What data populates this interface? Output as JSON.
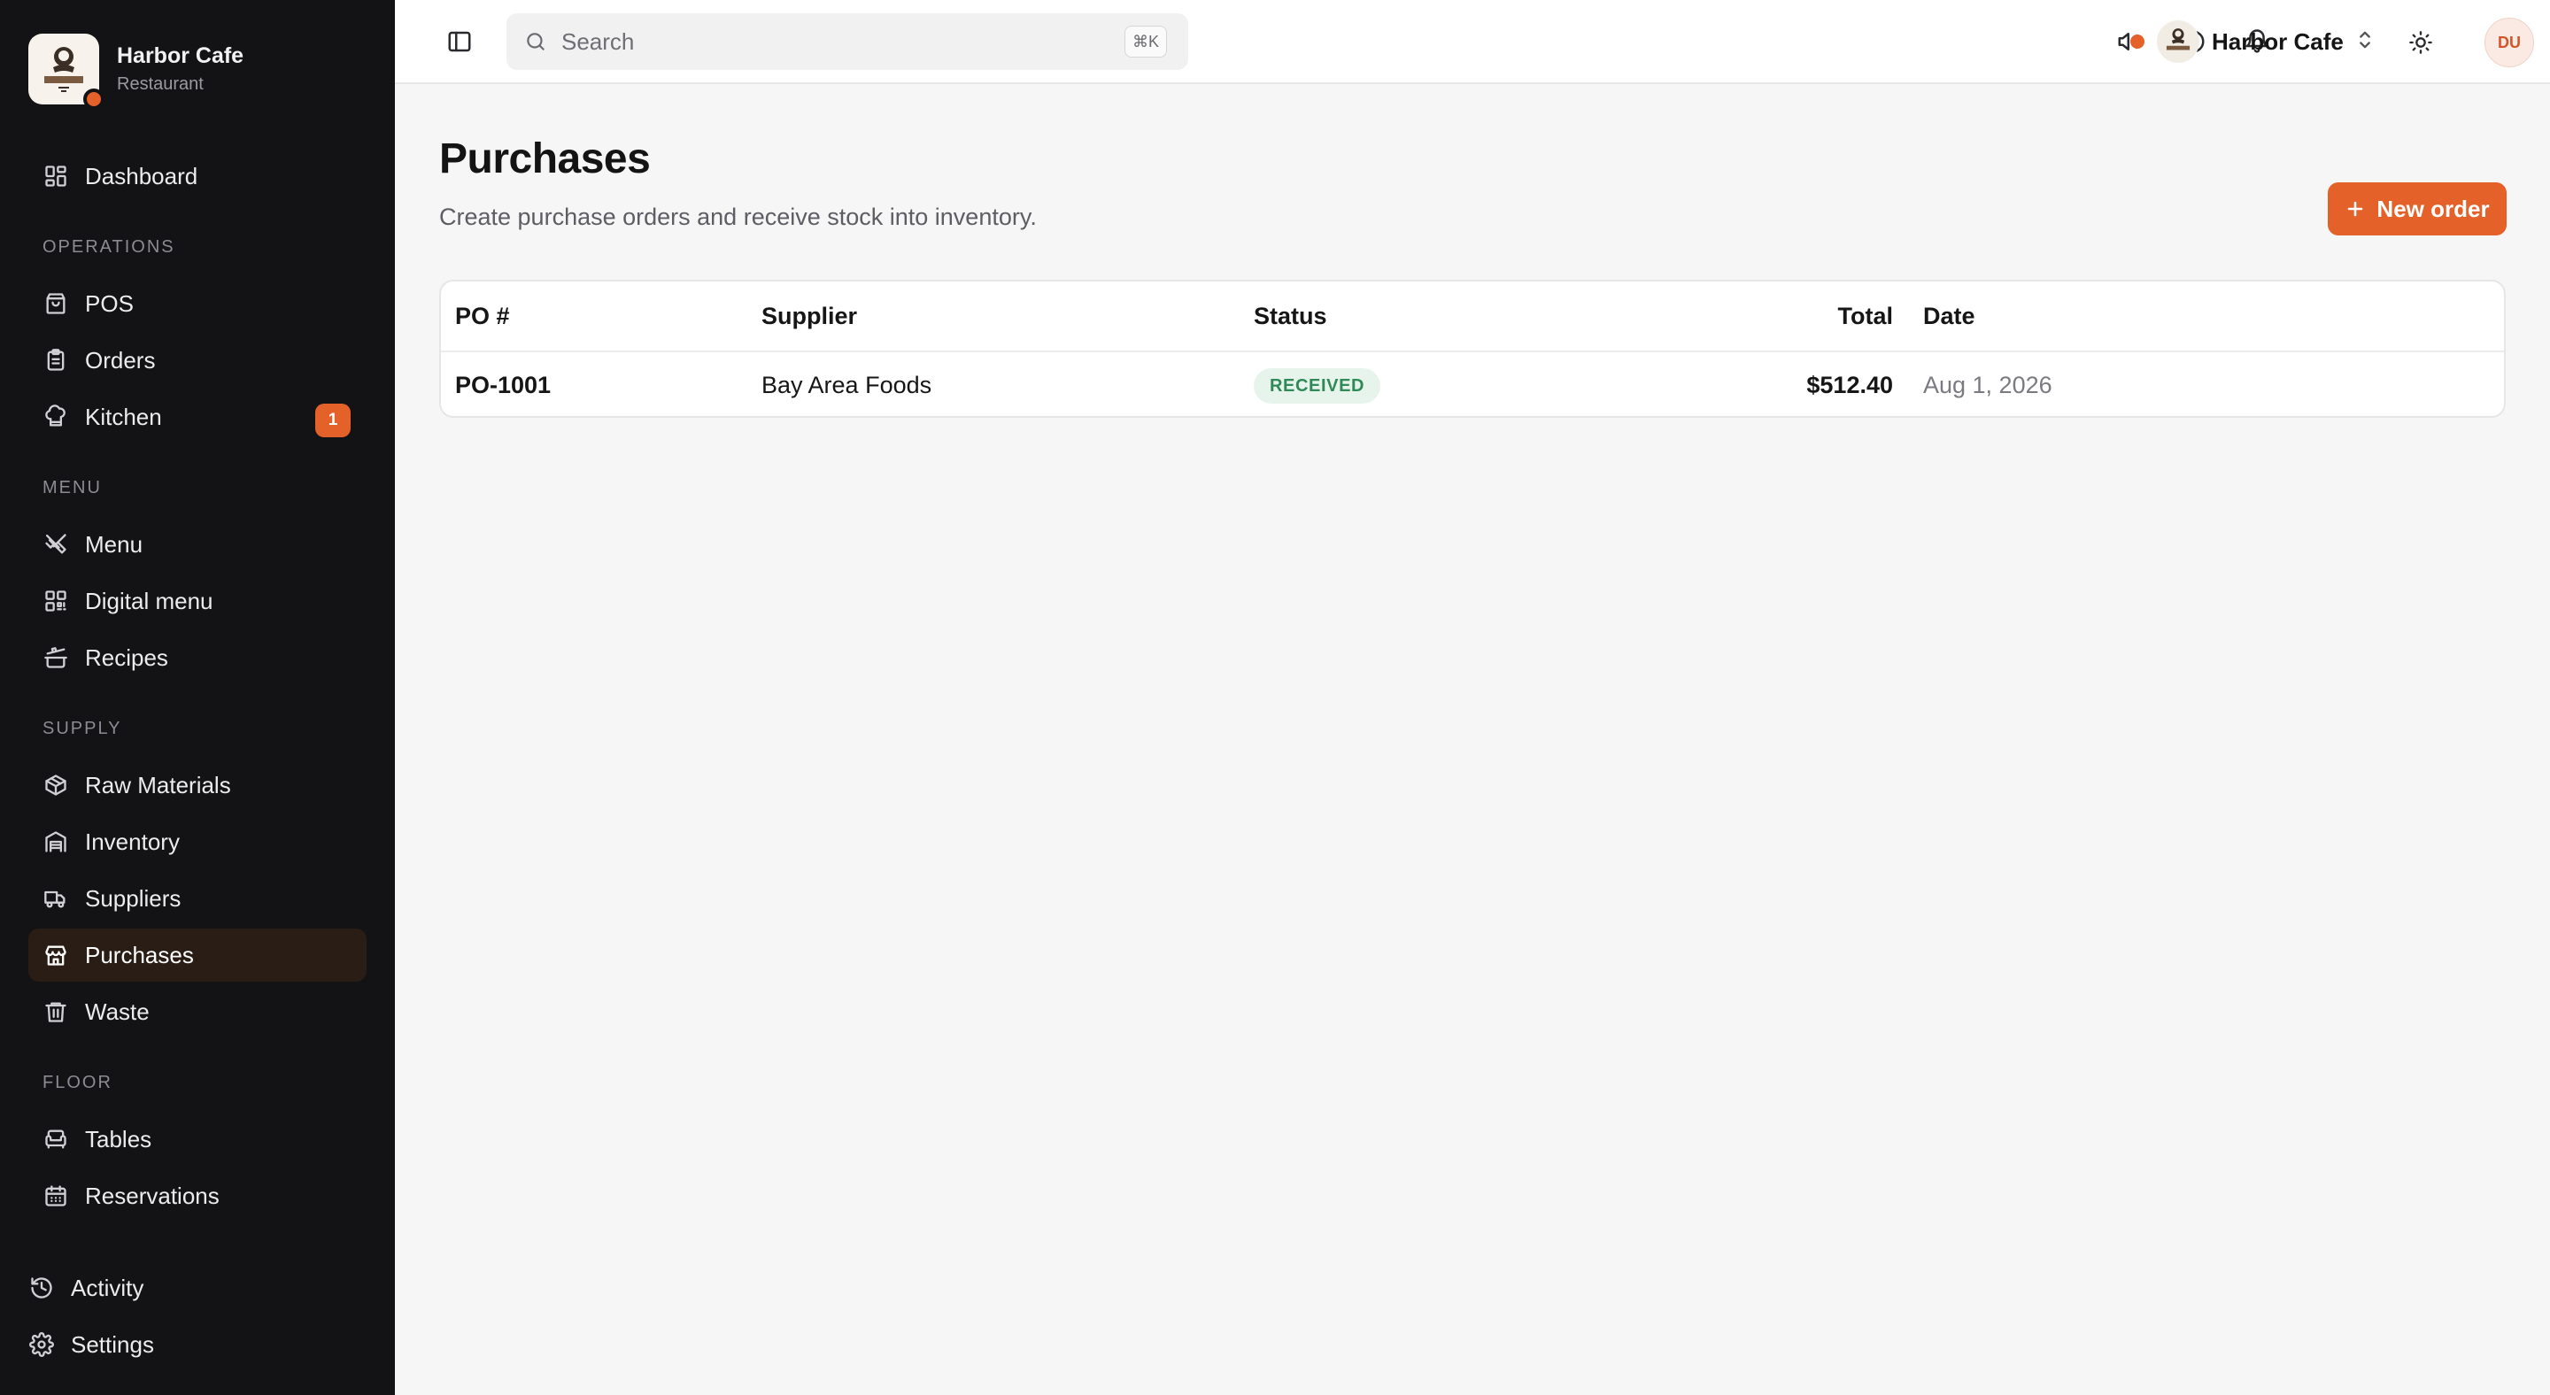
{
  "brand": {
    "name": "Harbor Cafe",
    "subtitle": "Restaurant"
  },
  "sidebar": {
    "dashboard": "Dashboard",
    "sections": {
      "operations": "OPERATIONS",
      "menu": "MENU",
      "supply": "SUPPLY",
      "floor": "FLOOR"
    },
    "items": {
      "pos": "POS",
      "orders": "Orders",
      "kitchen": "Kitchen",
      "kitchen_badge": "1",
      "menu": "Menu",
      "digital_menu": "Digital menu",
      "recipes": "Recipes",
      "raw_materials": "Raw Materials",
      "inventory": "Inventory",
      "suppliers": "Suppliers",
      "purchases": "Purchases",
      "waste": "Waste",
      "tables": "Tables",
      "reservations": "Reservations"
    },
    "bottom": {
      "activity": "Activity",
      "settings": "Settings"
    },
    "active_item": "purchases"
  },
  "topbar": {
    "search_placeholder": "Search",
    "search_shortcut": "⌘K",
    "workspace_name": "Harbor Cafe",
    "avatar_initials": "DU"
  },
  "page": {
    "title": "Purchases",
    "subtitle": "Create purchase orders and receive stock into inventory.",
    "new_order_label": "New order"
  },
  "table": {
    "columns": {
      "po": "PO #",
      "supplier": "Supplier",
      "status": "Status",
      "total": "Total",
      "date": "Date"
    },
    "rows": [
      {
        "po": "PO-1001",
        "supplier": "Bay Area Foods",
        "status": "RECEIVED",
        "total": "$512.40",
        "date": "Aug 1, 2026"
      }
    ]
  },
  "colors": {
    "accent": "#e4612a",
    "sidebar_bg": "#131316",
    "status_received_bg": "#e7f4ec",
    "status_received_fg": "#2f8a57"
  }
}
